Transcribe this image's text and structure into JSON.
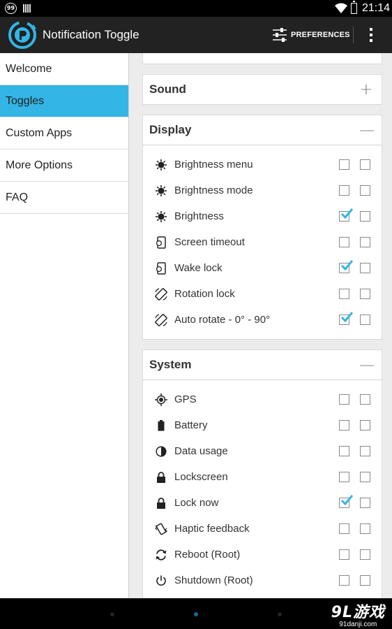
{
  "status_bar": {
    "badge": "99",
    "time": "21:14"
  },
  "action_bar": {
    "title": "Notification Toggle",
    "preferences_label": "PREFERENCES"
  },
  "sidebar": {
    "items": [
      {
        "label": "Welcome",
        "active": false
      },
      {
        "label": "Toggles",
        "active": true
      },
      {
        "label": "Custom Apps",
        "active": false
      },
      {
        "label": "More Options",
        "active": false
      },
      {
        "label": "FAQ",
        "active": false
      }
    ]
  },
  "colors": {
    "accent": "#33b5e5",
    "action_bar": "#222222",
    "check": "#33b5e5"
  },
  "sections": {
    "sound": {
      "title": "Sound",
      "expand_glyph": "+"
    },
    "display": {
      "title": "Display",
      "collapse_glyph": "—",
      "rows": [
        {
          "label": "Brightness menu",
          "icon": "brightness-icon",
          "check1": false,
          "check2": false
        },
        {
          "label": "Brightness mode",
          "icon": "brightness-icon",
          "check1": false,
          "check2": false
        },
        {
          "label": "Brightness",
          "icon": "brightness-icon",
          "check1": true,
          "check2": false
        },
        {
          "label": "Screen timeout",
          "icon": "screen-timeout-icon",
          "check1": false,
          "check2": false
        },
        {
          "label": "Wake lock",
          "icon": "wake-lock-icon",
          "check1": true,
          "check2": false
        },
        {
          "label": "Rotation lock",
          "icon": "rotation-icon",
          "check1": false,
          "check2": false
        },
        {
          "label": "Auto rotate - 0° - 90°",
          "icon": "rotation-icon",
          "check1": true,
          "check2": false
        }
      ]
    },
    "system": {
      "title": "System",
      "collapse_glyph": "—",
      "rows": [
        {
          "label": "GPS",
          "icon": "gps-icon",
          "check1": false,
          "check2": false
        },
        {
          "label": "Battery",
          "icon": "battery-icon",
          "check1": false,
          "check2": false
        },
        {
          "label": "Data usage",
          "icon": "data-usage-icon",
          "check1": false,
          "check2": false
        },
        {
          "label": "Lockscreen",
          "icon": "lock-icon",
          "check1": false,
          "check2": false
        },
        {
          "label": "Lock now",
          "icon": "lock-icon",
          "check1": true,
          "check2": false
        },
        {
          "label": "Haptic feedback",
          "icon": "haptic-icon",
          "check1": false,
          "check2": false
        },
        {
          "label": "Reboot (Root)",
          "icon": "reboot-icon",
          "check1": false,
          "check2": false
        },
        {
          "label": "Shutdown (Root)",
          "icon": "power-icon",
          "check1": false,
          "check2": false
        }
      ]
    }
  },
  "watermark": {
    "logo": "9L游戏",
    "url": "91danji.com"
  }
}
